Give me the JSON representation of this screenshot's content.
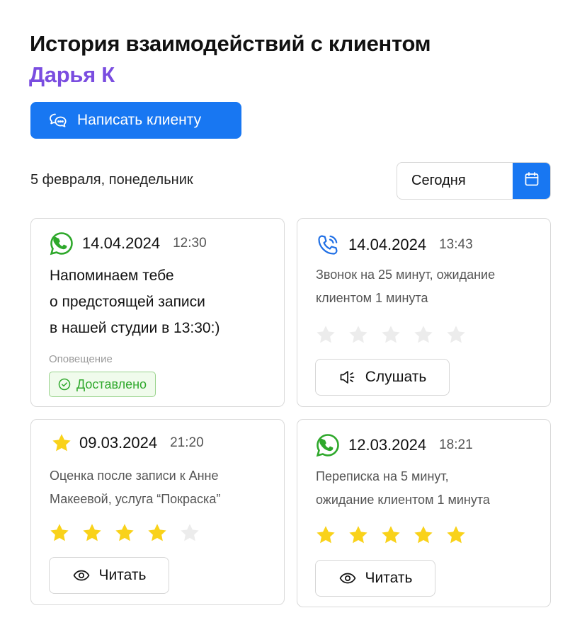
{
  "header": {
    "title": "История взаимодействий с клиентом",
    "client_name": "Дарья К",
    "client_name_color": "#7a4de0"
  },
  "write_button": {
    "label": "Написать клиенту",
    "icon": "chat-bubbles-icon",
    "color": "#1877f2"
  },
  "date_bar": {
    "label": "5 февраля, понедельник",
    "picker_value": "Сегодня",
    "picker_icon": "calendar-icon"
  },
  "colors": {
    "whatsapp": "#2ea82b",
    "phone": "#1f6fe5",
    "star_filled": "#f9d21a",
    "star_empty": "#ececec",
    "delivered": "#2ea82b"
  },
  "cards": [
    {
      "channel_icon": "whatsapp-icon",
      "date": "14.04.2024",
      "time": "12:30",
      "message": "Напоминаем тебе\nо предстоящей записи\nв нашей студии в 13:30:)",
      "note_label": "Оповещение",
      "status": "Доставлено"
    },
    {
      "channel_icon": "phone-icon",
      "date": "14.04.2024",
      "time": "13:43",
      "description": "Звонок на 25 минут, ожидание\nклиентом 1 минута",
      "rating": 0,
      "rating_max": 5,
      "action_label": "Слушать",
      "action_icon": "speaker-icon"
    },
    {
      "channel_icon": "star-icon",
      "date": "09.03.2024",
      "time": "21:20",
      "description": "Оценка после записи к Анне\nМакеевой, услуга “Покраска”",
      "rating": 4,
      "rating_max": 5,
      "action_label": "Читать",
      "action_icon": "eye-icon"
    },
    {
      "channel_icon": "whatsapp-icon",
      "date": "12.03.2024",
      "time": "18:21",
      "description": "Переписка на 5 минут,\nожидание клиентом 1 минута",
      "rating": 5,
      "rating_max": 5,
      "action_label": "Читать",
      "action_icon": "eye-icon"
    }
  ]
}
